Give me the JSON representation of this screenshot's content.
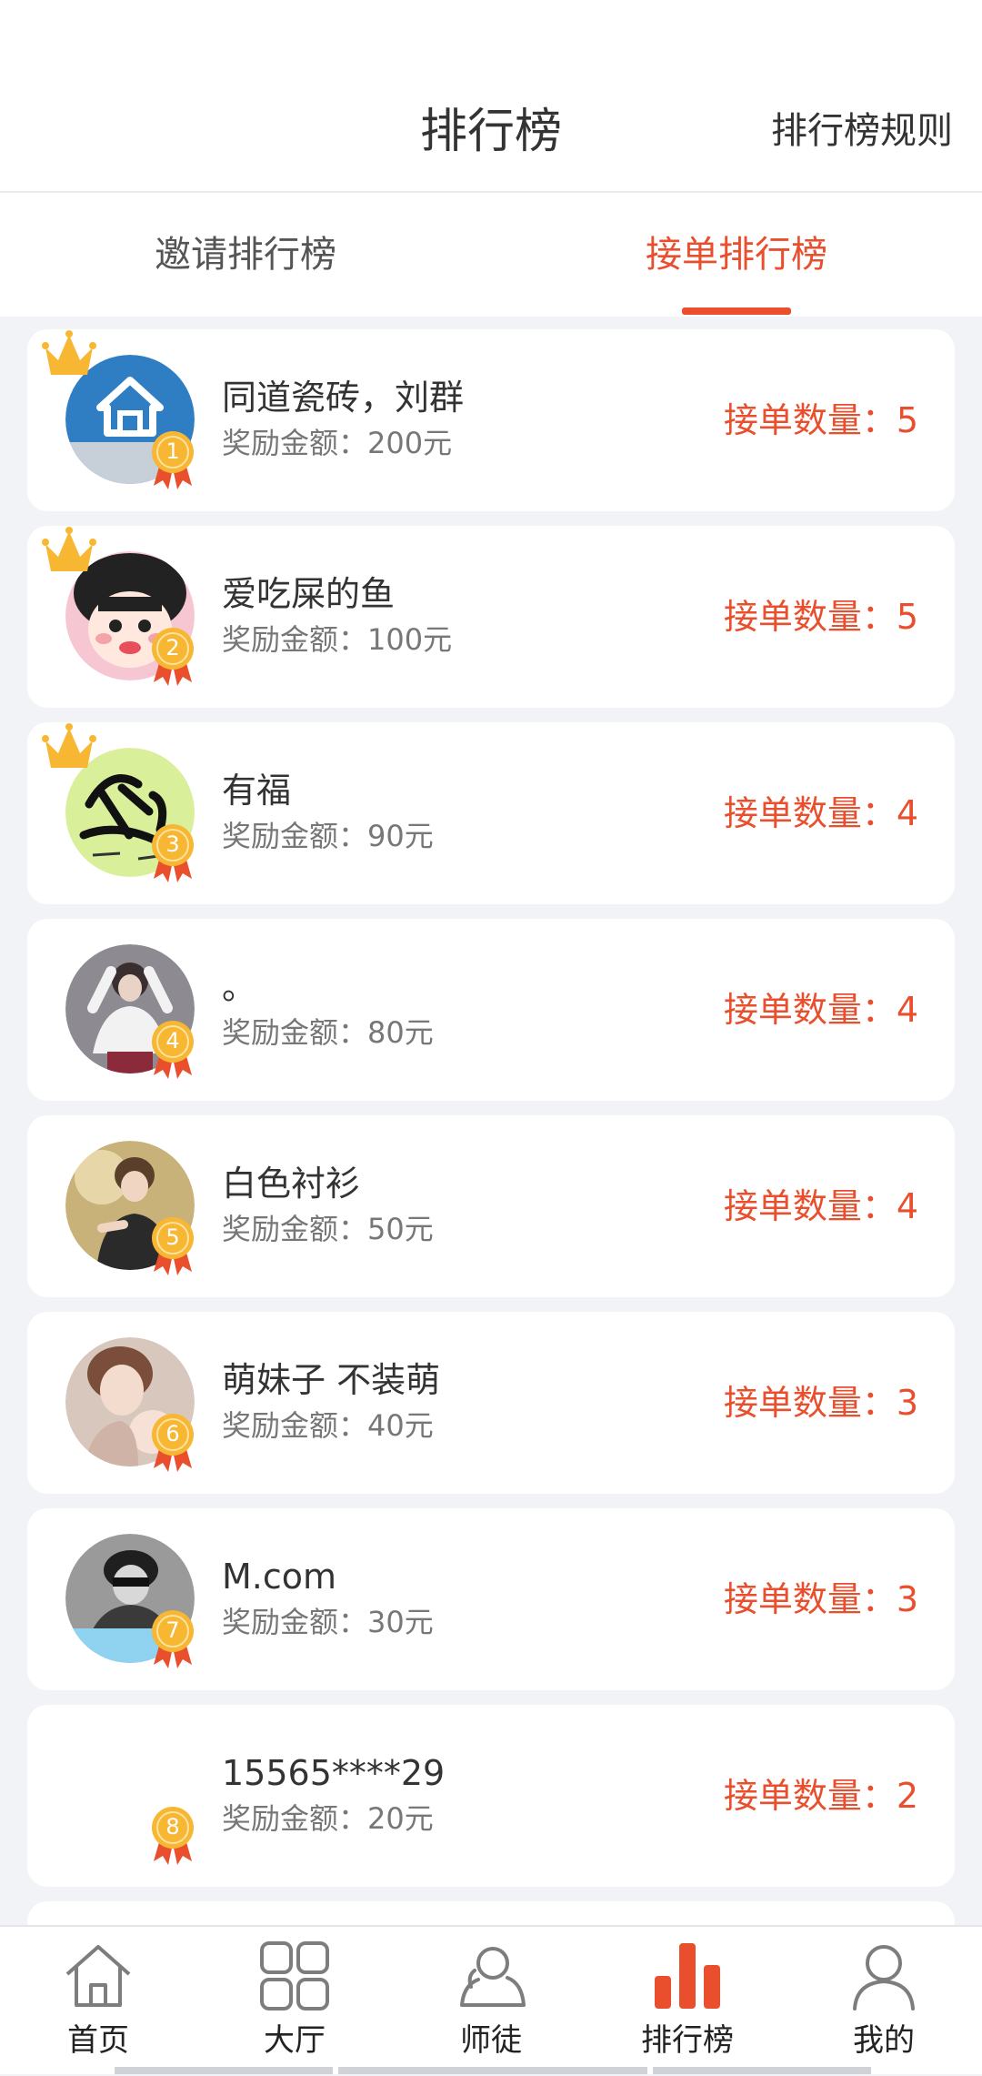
{
  "header": {
    "title": "排行榜",
    "rules_link": "排行榜规则"
  },
  "tabs": [
    {
      "label": "邀请排行榜",
      "active": false
    },
    {
      "label": "接单排行榜",
      "active": true
    }
  ],
  "colors": {
    "accent": "#e94e2d",
    "background": "#f1f3f6",
    "medal_gold": "#f7b733"
  },
  "ranking": [
    {
      "rank": "1",
      "name": "同道瓷砖，刘群",
      "reward": "奖励金额：200元",
      "count": "接单数量：5",
      "avatar": "house-logo-avatar",
      "crown": true
    },
    {
      "rank": "2",
      "name": "爱吃屎的鱼",
      "reward": "奖励金额：100元",
      "count": "接单数量：5",
      "avatar": "cartoon-girl-avatar",
      "crown": true
    },
    {
      "rank": "3",
      "name": "有福",
      "reward": "奖励金额：90元",
      "count": "接单数量：4",
      "avatar": "calligraphy-avatar",
      "crown": true
    },
    {
      "rank": "4",
      "name": "。",
      "reward": "奖励金额：80元",
      "count": "接单数量：4",
      "avatar": "girl-photo-avatar",
      "crown": false
    },
    {
      "rank": "5",
      "name": "白色衬衫",
      "reward": "奖励金额：50元",
      "count": "接单数量：4",
      "avatar": "boy-photo-avatar",
      "crown": false
    },
    {
      "rank": "6",
      "name": "萌妹子 不装萌",
      "reward": "奖励金额：40元",
      "count": "接单数量：3",
      "avatar": "mother-baby-avatar",
      "crown": false
    },
    {
      "rank": "7",
      "name": "M.com",
      "reward": "奖励金额：30元",
      "count": "接单数量：3",
      "avatar": "man-photo-avatar",
      "crown": false
    },
    {
      "rank": "8",
      "name": "15565****29",
      "reward": "奖励金额：20元",
      "count": "接单数量：2",
      "avatar": "blank-avatar",
      "crown": false
    }
  ],
  "tabbar": [
    {
      "label": "首页",
      "icon": "home-icon",
      "active": false
    },
    {
      "label": "大厅",
      "icon": "grid-icon",
      "active": false
    },
    {
      "label": "师徒",
      "icon": "people-icon",
      "active": false
    },
    {
      "label": "排行榜",
      "icon": "bar-chart-icon",
      "active": true
    },
    {
      "label": "我的",
      "icon": "user-icon",
      "active": false
    }
  ]
}
